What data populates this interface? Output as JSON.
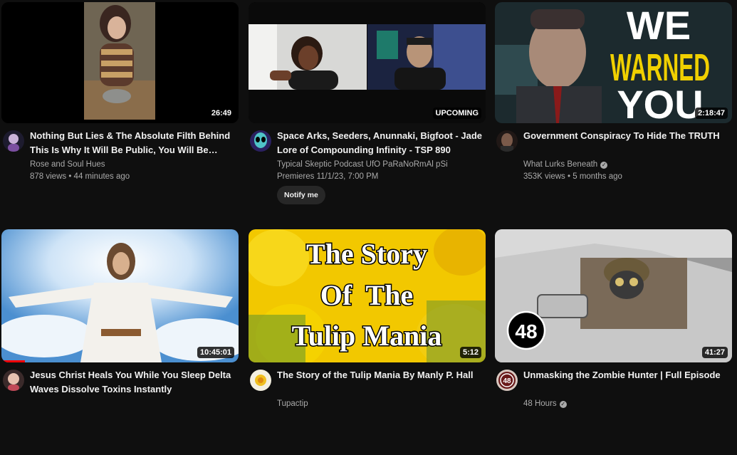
{
  "videos": [
    {
      "title": "Nothing But Lies & The Absolute Filth Behind This Is Why It Will Be Public, You Will Be…",
      "channel": "Rose and Soul Hues",
      "stats": "878 views • 44 minutes ago",
      "duration": "26:49"
    },
    {
      "title": "Space Arks, Seeders, Anunnaki, Bigfoot - Jade Lore of Compounding Infinity - TSP 890",
      "channel": "Typical Skeptic Podcast UfO PaRaNoRmAl pSi",
      "stats": "Premieres 11/1/23, 7:00 PM",
      "badge": "UPCOMING",
      "notify_label": "Notify me"
    },
    {
      "title": "Government Conspiracy To Hide The TRUTH",
      "channel": "What Lurks Beneath",
      "verified": true,
      "stats": "353K views • 5 months ago",
      "duration": "2:18:47",
      "thumb_text": [
        "WE",
        "WARNED",
        "YOU"
      ]
    },
    {
      "title": "Jesus Christ Heals You While You Sleep Delta Waves Dissolve Toxins Instantly",
      "channel": "",
      "stats": "",
      "duration": "10:45:01",
      "watch_progress": 0.1
    },
    {
      "title": "The Story of the Tulip Mania By Manly P. Hall",
      "channel": "Tupactip",
      "stats": "",
      "duration": "5:12",
      "thumb_text": [
        "The Story",
        "Of  The",
        "Tulip Mania"
      ]
    },
    {
      "title": "Unmasking the Zombie Hunter | Full Episode",
      "channel": "48 Hours",
      "verified": true,
      "stats": "",
      "duration": "41:27",
      "thumb_logo": "48"
    }
  ],
  "colors": {
    "background": "#0f0f0f",
    "title": "#f1f1f1",
    "secondary": "#aaaaaa",
    "progress": "#ff0000",
    "thumb_yellow": "#f0d000"
  }
}
